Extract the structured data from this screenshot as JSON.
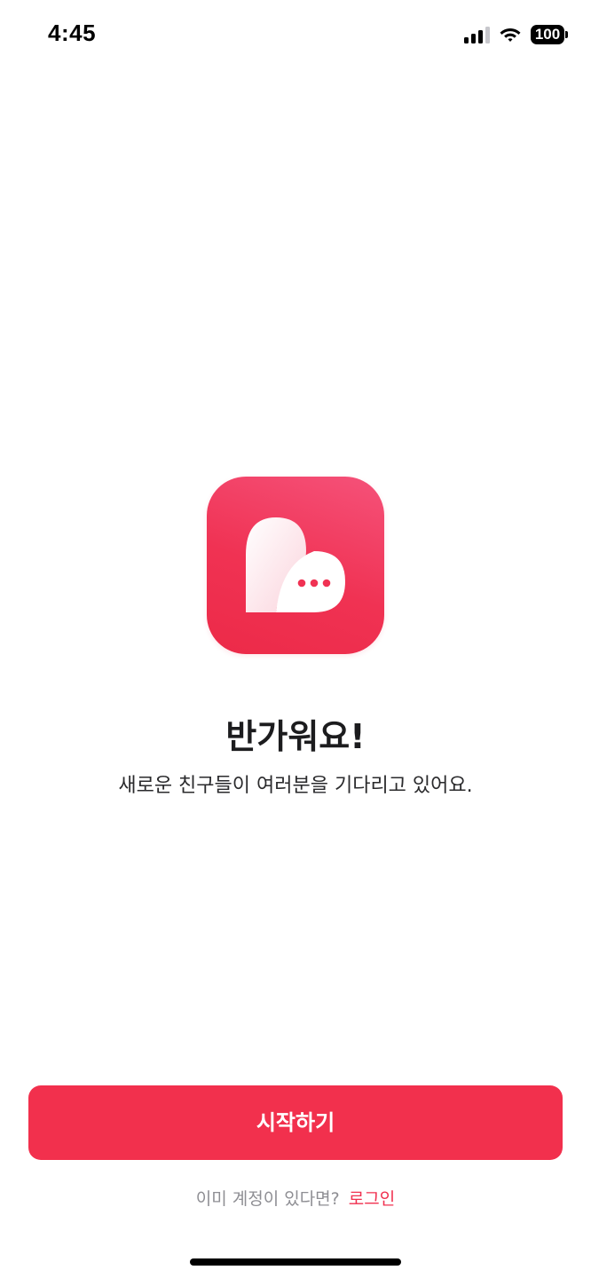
{
  "status_bar": {
    "time": "4:45",
    "battery": "100",
    "icons": [
      "signal-icon",
      "wifi-icon",
      "battery-icon"
    ]
  },
  "logo": {
    "icon": "heart-chat-bubble-icon",
    "colors": {
      "background": "#f03253",
      "accent_light": "#f5527a",
      "heart": "#ffffff",
      "dots": "#f03253"
    }
  },
  "welcome": {
    "title": "반가워요!",
    "subtitle": "새로운 친구들이 여러분을 기다리고 있어요."
  },
  "start_button": {
    "label": "시작하기",
    "color": "#f2304d"
  },
  "login": {
    "prompt": "이미 계정이 있다면?",
    "link_label": "로그인",
    "link_color": "#f0304f"
  }
}
